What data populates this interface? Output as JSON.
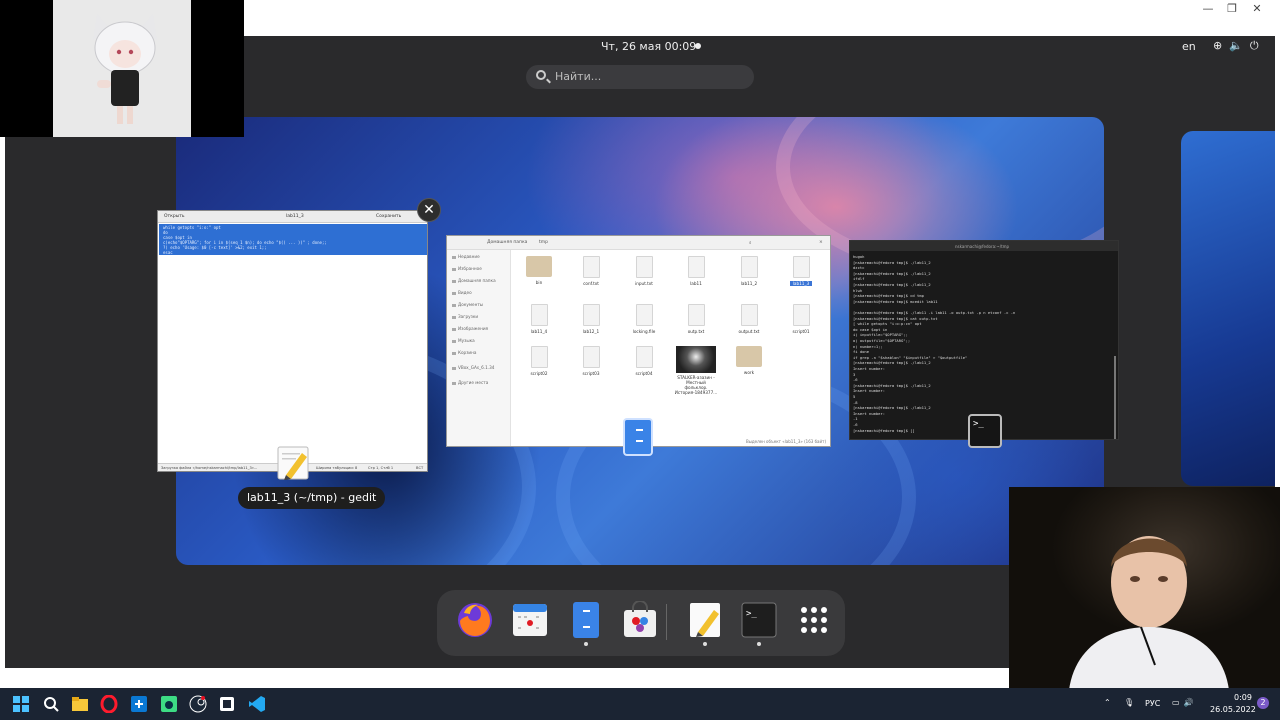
{
  "topbar": {
    "clock": "Чт, 26 мая 00:09",
    "lang": "en"
  },
  "search": {
    "placeholder": "Найти..."
  },
  "gedit": {
    "title": "lab11_3",
    "subtitle": "~/tmp",
    "open_label": "Открыть",
    "save_label": "Сохранить",
    "lines": [
      "while getopts \"i:o:\" opt",
      "do",
      "  case $opt in",
      "    c)echo\"$OPTARG\"; for i in $(seq 1 $n); do echo \"$(( ... ))\" ; done;;",
      "    ?) echo 'Usage: $0 [-c text]' >&2; exit 1;;",
      "esac"
    ],
    "status_left": "Загрузка файла «/home/nskarmachi/tmp/lab11_3»...",
    "status_mode": "Ширина табуляции: 8",
    "status_pos": "Стр 1, Стлб 1",
    "status_ins": "ВСТ"
  },
  "tooltip": "lab11_3 (~/tmp) - gedit",
  "files": {
    "path_home": "Домашняя папка",
    "path_tmp": "tmp",
    "sidebar": [
      "Недавние",
      "Избранное",
      "Домашняя папка",
      "Видео",
      "Документы",
      "Загрузки",
      "Изображения",
      "Музыка",
      "Корзина",
      "VBox_GAs_6.1.34",
      "Другие места"
    ],
    "items": [
      {
        "name": "bin",
        "kind": "folder"
      },
      {
        "name": "conf.txt",
        "kind": "doc"
      },
      {
        "name": "input.txt",
        "kind": "doc"
      },
      {
        "name": "lab11",
        "kind": "doc"
      },
      {
        "name": "lab11_2",
        "kind": "doc"
      },
      {
        "name": "lab11_3",
        "kind": "doc",
        "selected": true
      },
      {
        "name": "lab11_4",
        "kind": "doc"
      },
      {
        "name": "lab12_1",
        "kind": "doc"
      },
      {
        "name": "locking.file",
        "kind": "doc"
      },
      {
        "name": "outp.txt",
        "kind": "doc"
      },
      {
        "name": "output.txt",
        "kind": "doc"
      },
      {
        "name": "script01",
        "kind": "doc"
      },
      {
        "name": "script02",
        "kind": "doc"
      },
      {
        "name": "script03",
        "kind": "doc"
      },
      {
        "name": "script04",
        "kind": "doc"
      },
      {
        "name": "STALKER-азазин - Местный фольклор. История-1849377...",
        "kind": "image"
      },
      {
        "name": "work",
        "kind": "folder"
      }
    ],
    "status": "Выделен объект «lab11_3» (163 байт)"
  },
  "terminal": {
    "title": "nskarmachi@fedora:~/tmp",
    "lines": [
      "hugoh",
      "[nskarmachi@fedora tmp]$ ./lab11_2",
      "dzctc",
      "[nskarmachi@fedora tmp]$ ./lab11_2",
      "ifdlf",
      "[nskarmachi@fedora tmp]$ ./lab11_2",
      "hlwh",
      "[nskarmachi@fedora tmp]$ cd tmp",
      "[nskarmachi@fedora tmp]$ mcedit lab11",
      "",
      "[nskarmachi@fedora tmp]$ ./lab11 -i lab11 -o outp.txt -p n etconf -c -n",
      "[nskarmachi@fedora tmp]$ cat outp.txt",
      "[ while getopts \"i:o:p:cn\" opt",
      "do case $opt in",
      "  i) inputfile=\"$OPTARG\";;",
      "  o) outputfile=\"$OPTARG\";;",
      "  n) number=1;;",
      "fi done",
      "if grep -n \"$shablon\" \"$inputfile\" > \"$outputfile\"",
      "[nskarmachi@fedora tmp]$ ./lab11_2",
      "Insert number:",
      "3",
      "-6",
      "[nskarmachi@fedora tmp]$ ./lab11_2",
      "Insert number:",
      "5",
      "-8",
      "[nskarmachi@fedora tmp]$ ./lab11_2",
      "Insert number:",
      "-1",
      "-6",
      "[nskarmachi@fedora tmp]$ []"
    ]
  },
  "taskbar": {
    "lang": "РУС",
    "time": "0:09",
    "date": "26.05.2022",
    "notif": "2"
  }
}
